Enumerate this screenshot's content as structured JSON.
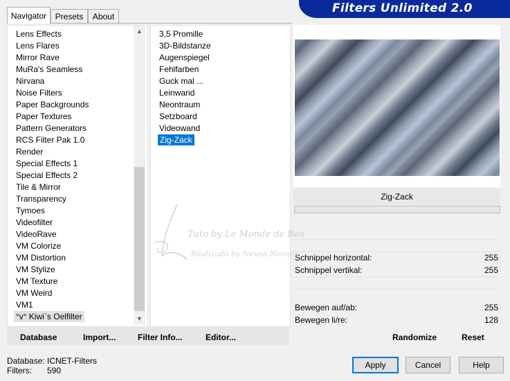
{
  "tabs": [
    {
      "label": "Navigator",
      "active": true
    },
    {
      "label": "Presets",
      "active": false
    },
    {
      "label": "About",
      "active": false
    }
  ],
  "banner": {
    "title": "Filters Unlimited 2.0",
    "color": "#0a2a9c"
  },
  "categories": [
    "Lens Effects",
    "Lens Flares",
    "Mirror Rave",
    "MuRa's Seamless",
    "Nirvana",
    "Noise Filters",
    "Paper Backgrounds",
    "Paper Textures",
    "Pattern Generators",
    "RCS Filter Pak 1.0",
    "Render",
    "Special Effects 1",
    "Special Effects 2",
    "Tile & Mirror",
    "Transparency",
    "Tymoes",
    "Videofilter",
    "VideoRave",
    "VM Colorize",
    "VM Distortion",
    "VM Stylize",
    "VM Texture",
    "VM Weird",
    "VM1",
    "°v° Kiwi`s Oelfilter"
  ],
  "filters": [
    "3,5 Promille",
    "3D-Bildstanze",
    "Augenspiegel",
    "Fehlfarben",
    "Guck mal ...",
    "Leinwand",
    "Neontraum",
    "Setzboard",
    "Videowand",
    "Zig-Zack"
  ],
  "selected_filter": "Zig-Zack",
  "parameters": [
    {
      "label": "Schnippel horizontal:",
      "value": "255"
    },
    {
      "label": "Schnippel vertikal:",
      "value": "255"
    },
    {
      "label": "Bewegen auf/ab:",
      "value": "255"
    },
    {
      "label": "Bewegen li/re:",
      "value": "128"
    }
  ],
  "toolbar": {
    "database": "Database",
    "import": "Import...",
    "filter_info": "Filter Info...",
    "editor": "Editor...",
    "randomize": "Randomize",
    "reset": "Reset"
  },
  "status": {
    "database_label": "Database:",
    "database_value": "ICNET-Filters",
    "filters_label": "Filters:",
    "filters_value": "590"
  },
  "buttons": {
    "apply": "Apply",
    "cancel": "Cancel",
    "help": "Help"
  },
  "watermark": {
    "line1": "Tuto by Le Monde de Bea",
    "line2": "Réalizado by Neusa Novaes"
  },
  "colors": {
    "selection": "#0078d7",
    "default_button_border": "#0078d7"
  }
}
